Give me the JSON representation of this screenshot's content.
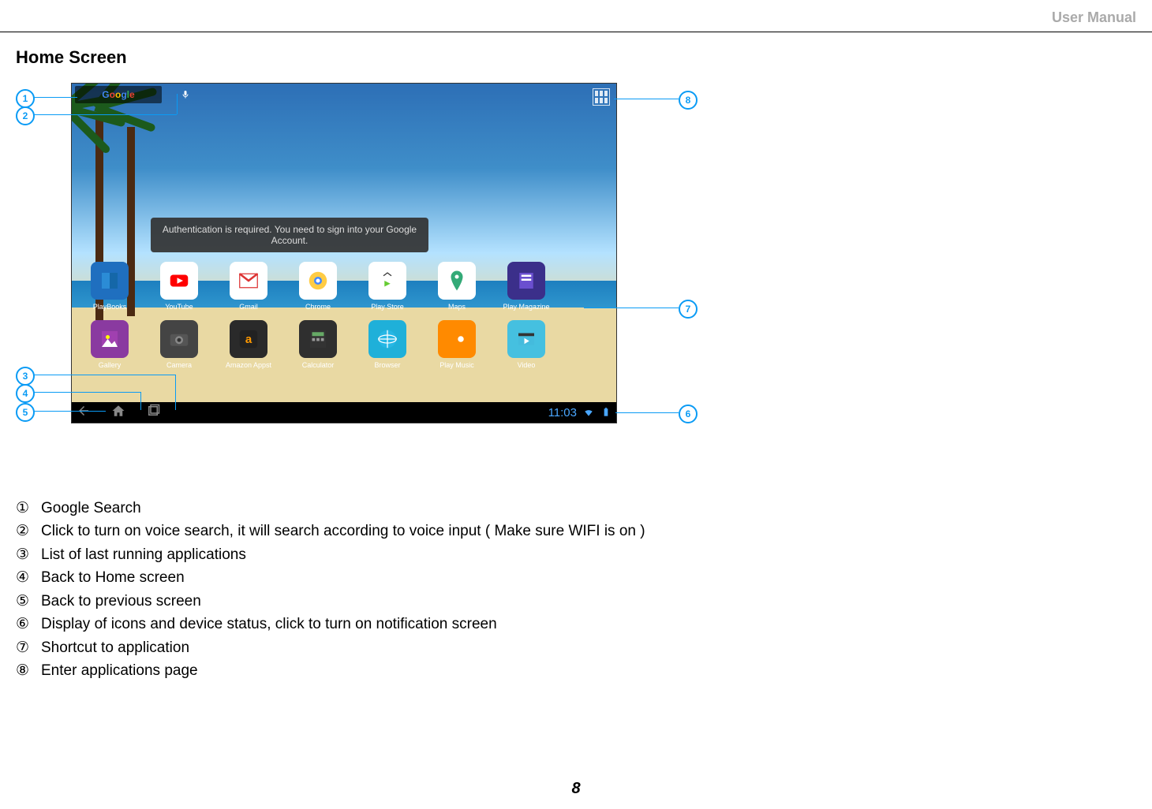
{
  "header": {
    "label": "User Manual"
  },
  "section": {
    "title": "Home Screen"
  },
  "screenshot": {
    "search_logo_letters": [
      "G",
      "o",
      "o",
      "g",
      "l",
      "e"
    ],
    "toast": "Authentication is required. You need to sign into your Google Account.",
    "statusbar": {
      "time": "11:03"
    },
    "apps_row1": [
      {
        "label": "PlayBooks",
        "bg": "#1f6fbf"
      },
      {
        "label": "YouTube",
        "bg": "#ffffff"
      },
      {
        "label": "Gmail",
        "bg": "#ffffff"
      },
      {
        "label": "Chrome",
        "bg": "#ffffff"
      },
      {
        "label": "Play Store",
        "bg": "#ffffff"
      },
      {
        "label": "Maps",
        "bg": "#ffffff"
      },
      {
        "label": "Play Magazine",
        "bg": "#3b2f8a"
      }
    ],
    "apps_row2": [
      {
        "label": "Gallery",
        "bg": "#8a3aa0"
      },
      {
        "label": "Camera",
        "bg": "#444444"
      },
      {
        "label": "Amazon Appst",
        "bg": "#2a2a2a"
      },
      {
        "label": "Calculator",
        "bg": "#2f2f2f"
      },
      {
        "label": "Browser",
        "bg": "#1fb0d9"
      },
      {
        "label": "Play Music",
        "bg": "#ff8a00"
      },
      {
        "label": "Video",
        "bg": "#45c0e0"
      }
    ]
  },
  "callouts": {
    "1": "1",
    "2": "2",
    "3": "3",
    "4": "4",
    "5": "5",
    "6": "6",
    "7": "7",
    "8": "8"
  },
  "legend": {
    "items": [
      {
        "num": "①",
        "text": "Google Search"
      },
      {
        "num": "②",
        "text": "Click to turn on voice search, it will search according to voice input ( Make sure WIFI is on )"
      },
      {
        "num": "③",
        "text": "List of last running applications"
      },
      {
        "num": "④",
        "text": "Back to Home screen"
      },
      {
        "num": "⑤",
        "text": "Back to previous screen"
      },
      {
        "num": "⑥",
        "text": "Display of icons and device status, click to turn on notification screen"
      },
      {
        "num": "⑦",
        "text": "Shortcut to application"
      },
      {
        "num": "⑧",
        "text": "Enter applications page"
      }
    ]
  },
  "page": {
    "number": "8"
  }
}
